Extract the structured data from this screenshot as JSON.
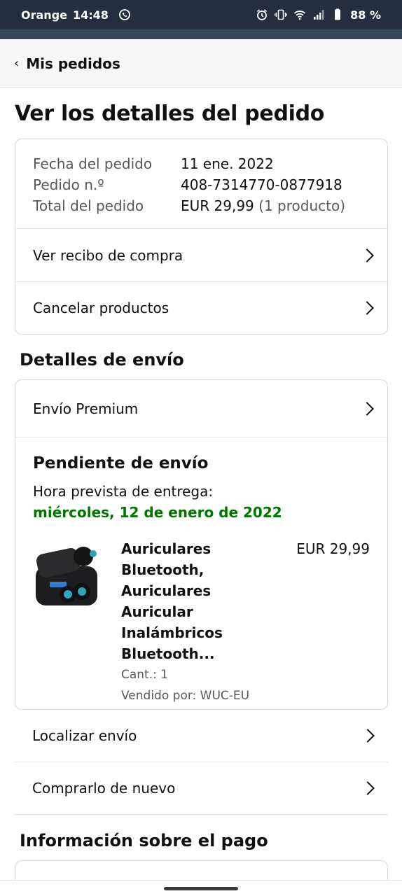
{
  "status_bar": {
    "carrier": "Orange",
    "time": "14:48",
    "battery": "88 %",
    "icons": [
      "whatsapp-icon",
      "alarm-icon",
      "vibrate-icon",
      "wifi-icon",
      "signal-icon",
      "battery-icon"
    ]
  },
  "header": {
    "back_label": "Mis pedidos"
  },
  "page_title": "Ver los detalles del pedido",
  "order_summary": {
    "date_label": "Fecha del pedido",
    "date_value": "11 ene. 2022",
    "number_label": "Pedido n.º",
    "number_value": "408-7314770-0877918",
    "total_label": "Total del pedido",
    "total_value": "EUR 29,99",
    "total_count": "(1 producto)"
  },
  "order_actions": [
    "Ver recibo de compra",
    "Cancelar productos"
  ],
  "shipping": {
    "section_title": "Detalles de envío",
    "method": "Envío Premium",
    "status": "Pendiente de envío",
    "estimate_label": "Hora prevista de entrega:",
    "estimate_date": "miércoles, 12 de enero de 2022",
    "product": {
      "title": "Auriculares Bluetooth, Auriculares Auricular Inalámbricos Bluetooth...",
      "quantity": "Cant.: 1",
      "seller": "Vendido por: WUC-EU",
      "price": "EUR 29,99"
    }
  },
  "shipment_actions": [
    "Localizar envío",
    "Comprarlo de nuevo"
  ],
  "payment": {
    "section_title": "Información sobre el pago"
  },
  "colors": {
    "status_bar": "#232f3e",
    "delivery_green": "#007600",
    "border": "#d5d9d9"
  }
}
